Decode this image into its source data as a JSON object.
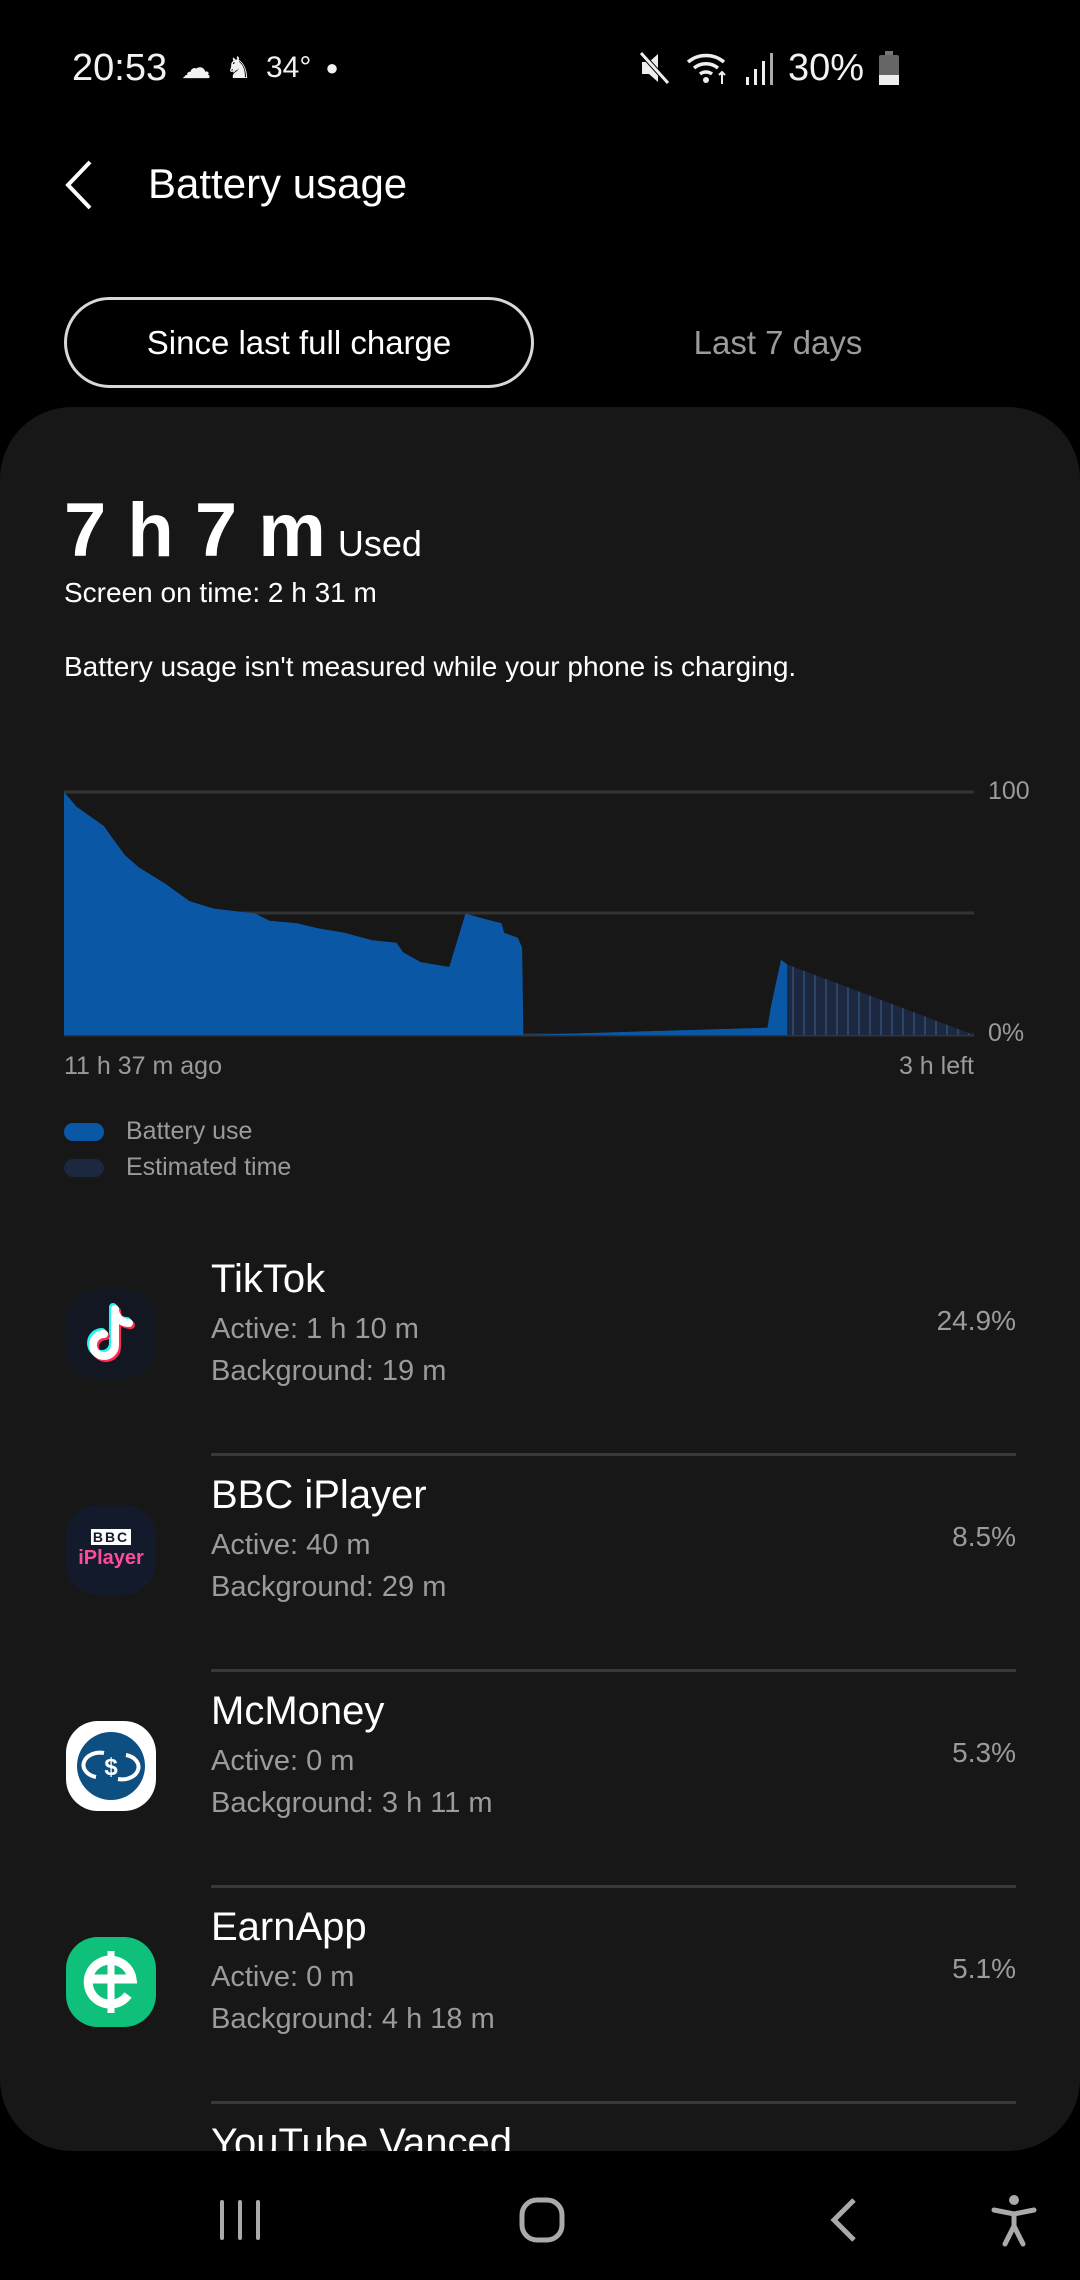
{
  "status_bar": {
    "time": "20:53",
    "temperature": "34°",
    "battery": "30%",
    "icons": [
      "weather-icon",
      "notification-icon",
      "dot-icon",
      "mute-icon",
      "wifi-icon",
      "signal-icon",
      "battery-icon"
    ]
  },
  "header": {
    "title": "Battery usage",
    "back_icon": "chevron-left-icon"
  },
  "tabs": [
    {
      "label": "Since last full charge",
      "selected": true
    },
    {
      "label": "Last 7 days",
      "selected": false
    }
  ],
  "summary": {
    "used_time": "7 h 7 m",
    "used_label": "Used",
    "screen_on": "Screen on time: 2 h 31 m",
    "note": "Battery usage isn't measured while your phone is charging."
  },
  "chart_data": {
    "type": "area",
    "x_unit": "hours relative to now",
    "xlim": [
      -11.62,
      3
    ],
    "ylim": [
      0,
      100
    ],
    "y_tick_labels": [
      "100",
      "0%"
    ],
    "x_tick_labels": [
      "11 h 37 m ago",
      "3 h left"
    ],
    "grid": true,
    "legend_placement": "bottom-left",
    "colors": {
      "battery_use": "#0a58a5",
      "estimated": "#1c2740"
    },
    "series": [
      {
        "name": "Battery use",
        "points": [
          [
            -11.62,
            100
          ],
          [
            -11.42,
            94
          ],
          [
            -10.98,
            86
          ],
          [
            -10.87,
            82
          ],
          [
            -10.64,
            74
          ],
          [
            -10.42,
            69
          ],
          [
            -9.98,
            62
          ],
          [
            -9.76,
            58
          ],
          [
            -9.6,
            55
          ],
          [
            -9.21,
            52
          ],
          [
            -8.55,
            50
          ],
          [
            -8.32,
            47
          ],
          [
            -7.88,
            46
          ],
          [
            -7.55,
            44
          ],
          [
            -7.11,
            42
          ],
          [
            -6.67,
            39
          ],
          [
            -6.28,
            38
          ],
          [
            -6.17,
            34
          ],
          [
            -5.89,
            30
          ],
          [
            -5.43,
            28
          ],
          [
            -5.17,
            50
          ],
          [
            -4.9,
            48
          ],
          [
            -4.59,
            46
          ],
          [
            -4.55,
            42
          ],
          [
            -4.33,
            40
          ],
          [
            -4.26,
            36
          ],
          [
            -4.24,
            0
          ],
          [
            -0.32,
            3
          ],
          [
            -0.26,
            12
          ],
          [
            -0.1,
            31
          ],
          [
            0,
            29
          ]
        ]
      },
      {
        "name": "Estimated time",
        "points": [
          [
            0,
            29
          ],
          [
            3,
            0
          ]
        ]
      }
    ]
  },
  "apps": [
    {
      "name": "TikTok",
      "active": "Active: 1 h 10 m",
      "background": "Background: 19 m",
      "percent": "24.9%",
      "icon": "tiktok-icon"
    },
    {
      "name": "BBC iPlayer",
      "active": "Active: 40 m",
      "background": "Background: 29 m",
      "percent": "8.5%",
      "icon": "bbc-iplayer-icon",
      "icon_text": [
        "BBC",
        "iPlayer"
      ]
    },
    {
      "name": "McMoney",
      "active": "Active: 0 m",
      "background": "Background: 3 h 11 m",
      "percent": "5.3%",
      "icon": "mcmoney-icon"
    },
    {
      "name": "EarnApp",
      "active": "Active: 0 m",
      "background": "Background: 4 h 18 m",
      "percent": "5.1%",
      "icon": "earnapp-icon"
    },
    {
      "name": "YouTube Vanced"
    }
  ],
  "nav_bar": [
    "recents-icon",
    "home-icon",
    "back-icon",
    "accessibility-icon"
  ]
}
